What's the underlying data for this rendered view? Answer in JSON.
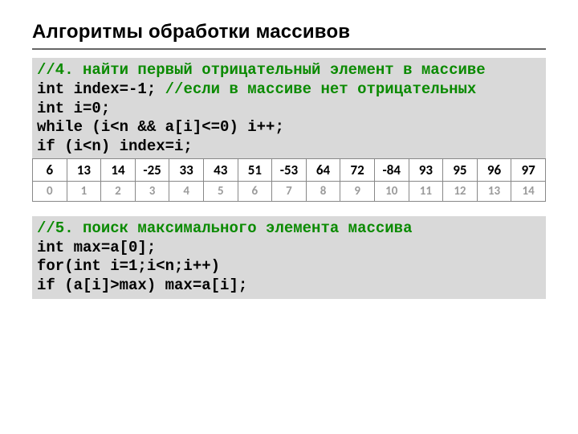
{
  "title": "Алгоритмы обработки массивов",
  "block1": {
    "c1": "//4. найти первый отрицательный элемент в массиве",
    "l1": "int index=-1; ",
    "c2": "//если в массиве нет отрицательных",
    "l2": "int i=0;",
    "l3": "while (i<n && a[i]<=0) i++;",
    "l4": "if (i<n) index=i;"
  },
  "array": {
    "values": [
      "6",
      "13",
      "14",
      "-25",
      "33",
      "43",
      "51",
      "-53",
      "64",
      "72",
      "-84",
      "93",
      "95",
      "96",
      "97"
    ],
    "indices": [
      "0",
      "1",
      "2",
      "3",
      "4",
      "5",
      "6",
      "7",
      "8",
      "9",
      "10",
      "11",
      "12",
      "13",
      "14"
    ]
  },
  "block2": {
    "c1": "//5. поиск максимального элемента массива",
    "l1": "int max=a[0];",
    "l2": "for(int i=1;i<n;i++)",
    "l3": "if (a[i]>max) max=a[i];"
  }
}
